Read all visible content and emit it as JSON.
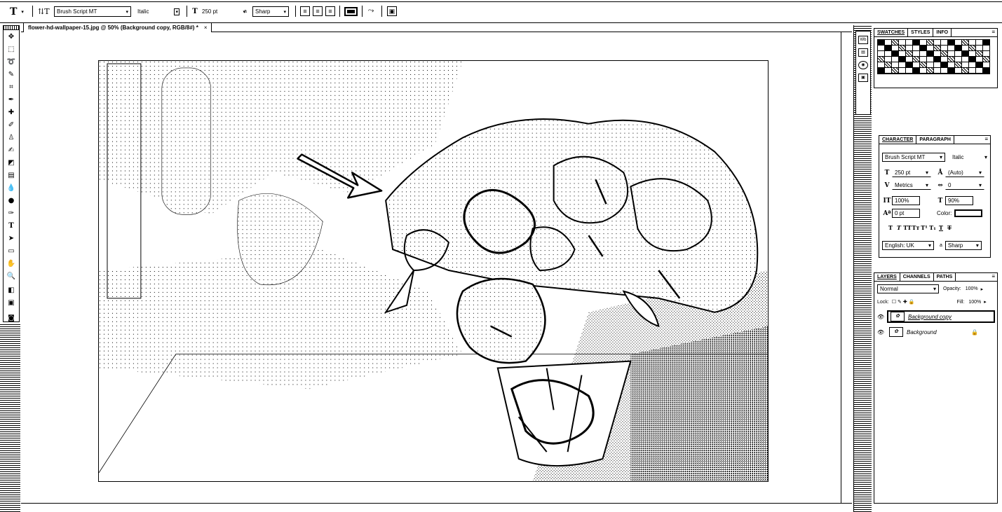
{
  "options_bar": {
    "tool_icon": "type-tool-icon",
    "font_family": "Brush Script MT",
    "font_style": "Italic",
    "font_size": "250 pt",
    "antialias_icon_text": "a",
    "antialias": "Sharp"
  },
  "document": {
    "tab_title": "flower-hd-wallpaper-15.jpg @ 50% (Background copy, RGB/8#) *",
    "close_glyph": "×"
  },
  "swatches_panel": {
    "tabs": [
      "SWATCHES",
      "STYLES",
      "INFO"
    ]
  },
  "character_panel": {
    "tabs": [
      "CHARACTER",
      "PARAGRAPH"
    ],
    "font_family": "Brush Script MT",
    "font_style": "Italic",
    "font_size": "250 pt",
    "leading": "(Auto)",
    "kerning": "Metrics",
    "tracking": "0",
    "vertical_scale": "100%",
    "horizontal_scale": "90%",
    "baseline_shift": "0 pt",
    "color_label": "Color:",
    "language": "English: UK",
    "antialias_icon_text": "a",
    "antialias": "Sharp"
  },
  "layers_panel": {
    "tabs": [
      "LAYERS",
      "CHANNELS",
      "PATHS"
    ],
    "blend_mode": "Normal",
    "opacity_label": "Opacity:",
    "opacity": "100%",
    "lock_label": "Lock:",
    "fill_label": "Fill:",
    "fill": "100%",
    "layers": [
      {
        "name": "Background copy",
        "selected": true
      },
      {
        "name": "Background",
        "selected": false
      }
    ]
  }
}
